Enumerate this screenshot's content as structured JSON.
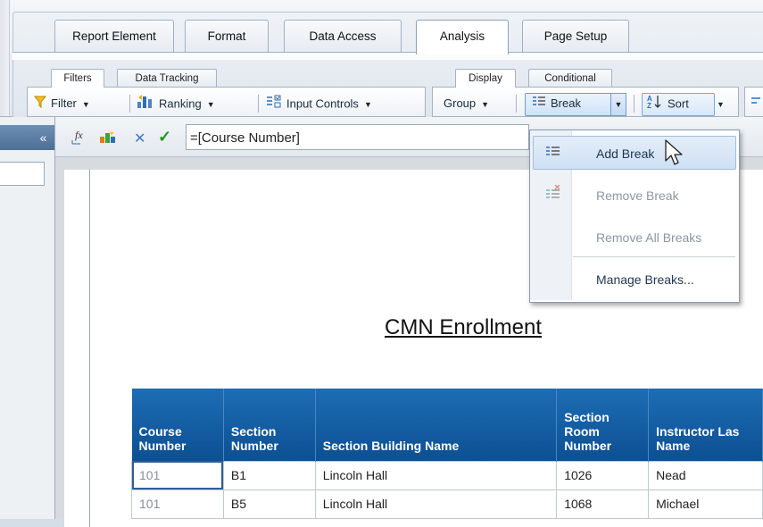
{
  "ribbon": {
    "main_tabs": [
      "Report Element",
      "Format",
      "Data Access",
      "Analysis",
      "Page Setup"
    ],
    "active_tab": "Analysis",
    "left_subtabs": [
      "Filters",
      "Data Tracking"
    ],
    "right_subtabs": [
      "Display",
      "Conditional"
    ],
    "tools": {
      "filter": "Filter",
      "ranking": "Ranking",
      "input_controls": "Input Controls",
      "group": "Group",
      "break": "Break",
      "sort": "Sort"
    }
  },
  "formula": {
    "collapse_symbol": "«",
    "value": "=[Course Number]"
  },
  "break_menu": {
    "items": [
      {
        "label": "Add Break",
        "enabled": true
      },
      {
        "label": "Remove Break",
        "enabled": false
      },
      {
        "label": "Remove All Breaks",
        "enabled": false
      },
      {
        "label": "Manage Breaks...",
        "enabled": true
      }
    ]
  },
  "report": {
    "title": "CMN Enrollment",
    "columns": [
      {
        "line1": "Course",
        "line2": "Number",
        "line3": ""
      },
      {
        "line1": "Section",
        "line2": "Number",
        "line3": ""
      },
      {
        "line1": "Section Building Name",
        "line2": "",
        "line3": ""
      },
      {
        "line1": "Section",
        "line2": "Room",
        "line3": "Number"
      },
      {
        "line1": "Instructor Las",
        "line2": "Name",
        "line3": ""
      }
    ],
    "rows": [
      [
        "101",
        "B1",
        "Lincoln Hall",
        "1026",
        "Nead"
      ],
      [
        "101",
        "B5",
        "Lincoln Hall",
        "1068",
        "Michael"
      ]
    ]
  },
  "colors": {
    "header_blue": "#0d4f92",
    "selection_border": "#2e5f98",
    "menu_highlight": "#cfe0f4"
  }
}
